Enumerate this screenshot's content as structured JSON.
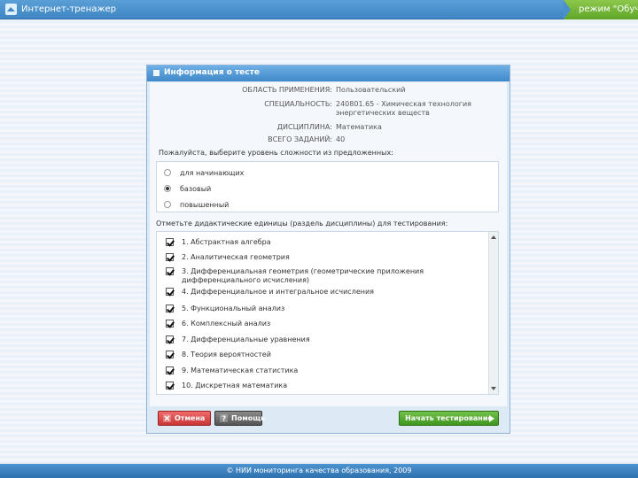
{
  "app": {
    "title": "Интернет-тренажер",
    "mode": "режим \"Обучение\""
  },
  "dialog": {
    "title": "Информация о тесте",
    "info": [
      {
        "label": "ОБЛАСТЬ ПРИМЕНЕНИЯ:",
        "value": "Пользовательский"
      },
      {
        "label": "СПЕЦИАЛЬНОСТЬ:",
        "value": "240801.65 - Химическая технология",
        "value2": "энергетических веществ"
      },
      {
        "label": "ДИСЦИПЛИНА:",
        "value": "Математика"
      },
      {
        "label": "ВСЕГО ЗАДАНИЙ:",
        "value": "40"
      }
    ],
    "level_prompt": "Пожалуйста, выберите уровень сложности из предложенных:",
    "levels": [
      {
        "label": "для начинающих",
        "checked": false
      },
      {
        "label": "базовый",
        "checked": true
      },
      {
        "label": "повышенный",
        "checked": false
      }
    ],
    "units_prompt": "Отметьте дидактические единицы (раздель дисциплины) для тестирования:",
    "units": [
      {
        "label": "1. Абстрактная алгебра",
        "checked": true
      },
      {
        "label": "2. Аналитическая геометрия",
        "checked": true
      },
      {
        "label": "3. Дифференциальная геометрия (геометрические приложения дифференциального исчисления)",
        "checked": true
      },
      {
        "label": "4. Дифференциальное и интегральное исчисления",
        "checked": true
      },
      {
        "label": "5. Функциональный анализ",
        "checked": true
      },
      {
        "label": "6. Комплексный анализ",
        "checked": true
      },
      {
        "label": "7. Дифференциальные уравнения",
        "checked": true
      },
      {
        "label": "8. Теория вероятностей",
        "checked": true
      },
      {
        "label": "9. Математическая статистика",
        "checked": true
      },
      {
        "label": "10. Дискретная математика",
        "checked": true
      }
    ],
    "buttons": {
      "cancel": "Отмена",
      "help": "Помощь",
      "start": "Начать тестирование"
    }
  },
  "footer": {
    "copyright": "© НИИ мониторинга качества образования, 2009"
  },
  "colors": {
    "header": "#3f88c8",
    "mode_badge": "#5ea52a",
    "cancel": "#c93535",
    "start": "#3f9620"
  }
}
